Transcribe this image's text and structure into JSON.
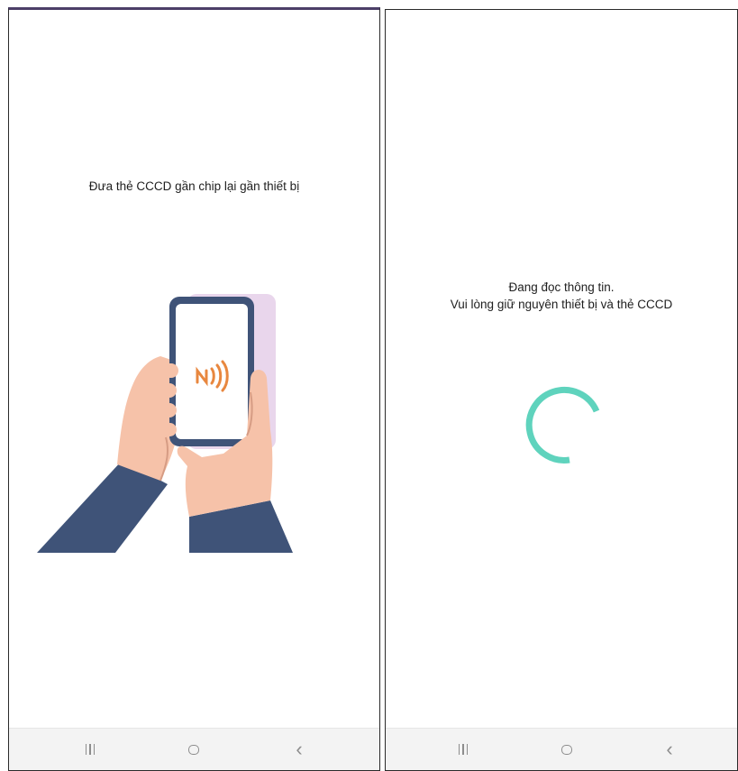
{
  "left_screen": {
    "instruction": "Đưa thẻ CCCD gần chip lại gần thiết bị",
    "illustration_icon": "hand-holding-phone-nfc",
    "nfc_icon": "nfc-icon"
  },
  "right_screen": {
    "status_line_1": "Đang đọc thông tin.",
    "status_line_2": "Vui lòng giữ nguyên thiết bị và thẻ CCCD",
    "spinner_icon": "loading-spinner",
    "accent_color": "#5fd3bd"
  },
  "navbar": {
    "recent_icon": "recent-apps-icon",
    "home_icon": "home-icon",
    "back_icon": "back-icon",
    "back_glyph": "‹"
  },
  "colors": {
    "sleeve": "#3f5378",
    "skin": "#f6c2a9",
    "phone_frame": "#3f5378",
    "card": "#e9d6ec",
    "nfc_waves": "#e8873f",
    "navbar_bg": "#f3f3f3"
  }
}
